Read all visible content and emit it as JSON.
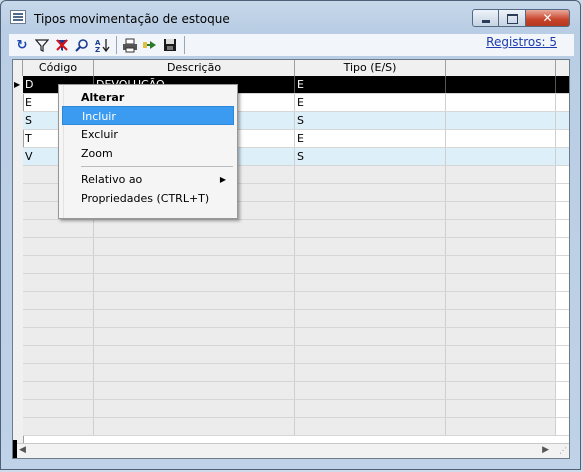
{
  "window": {
    "title": "Tipos movimentação de estoque",
    "close_glyph": "✕"
  },
  "toolbar": {
    "icons": [
      "refresh-icon",
      "filter-icon",
      "clear-filter-icon",
      "find-icon",
      "sort-icon",
      "print-icon",
      "export-icon",
      "save-icon"
    ],
    "registros": "Registros: 5"
  },
  "grid": {
    "columns": [
      "Código",
      "Descrição",
      "Tipo (E/S)",
      ""
    ],
    "rows": [
      {
        "codigo": "D",
        "descricao": "DEVOLUÇÃO",
        "tipo": "E"
      },
      {
        "codigo": "E",
        "descricao": "",
        "tipo": "E"
      },
      {
        "codigo": "S",
        "descricao": "",
        "tipo": "S"
      },
      {
        "codigo": "T",
        "descricao": "",
        "tipo": "E"
      },
      {
        "codigo": "V",
        "descricao": "",
        "tipo": "S"
      }
    ]
  },
  "context_menu": {
    "items": [
      "Alterar",
      "Incluir",
      "Excluir",
      "Zoom",
      "Relativo ao",
      "Propriedades (CTRL+T)"
    ],
    "highlighted": "Incluir"
  },
  "colors": {
    "selected_row": "#000000",
    "alt_row": "#ddf0fa",
    "menu_highlight": "#3b9bf0",
    "link": "#1c3cae"
  }
}
